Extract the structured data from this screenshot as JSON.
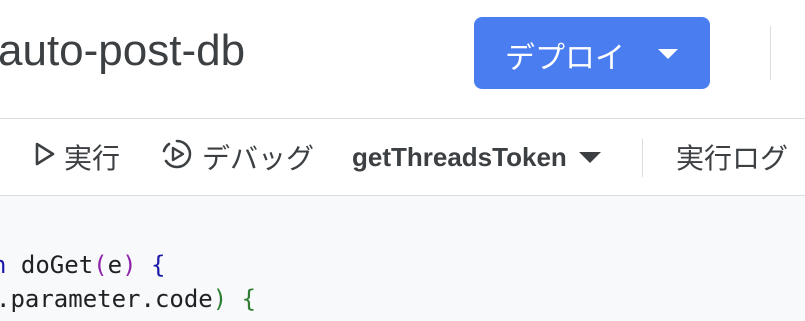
{
  "header": {
    "project_title": "auto-post-db",
    "deploy_label": "デプロイ"
  },
  "toolbar": {
    "run_label": "実行",
    "debug_label": "デバッグ",
    "function_name": "getThreadsToken",
    "log_label": "実行ログ"
  },
  "editor": {
    "line1": {
      "keyword_tail": "n",
      "name": " doGet",
      "open_paren": "(",
      "param": "e",
      "close_paren": ")",
      "open_brace": " {"
    },
    "line2": {
      "text": ".parameter.code",
      "close_paren": ")",
      "open_brace": " {"
    }
  },
  "colors": {
    "accent": "#4a7df0",
    "text": "#3c4043",
    "editor_bg": "#f8f9fa",
    "divider": "#dadce0"
  },
  "icons": {
    "run": "play-icon",
    "debug": "debug-icon",
    "function_dropdown": "caret-down-icon",
    "deploy_dropdown": "caret-down-icon"
  }
}
